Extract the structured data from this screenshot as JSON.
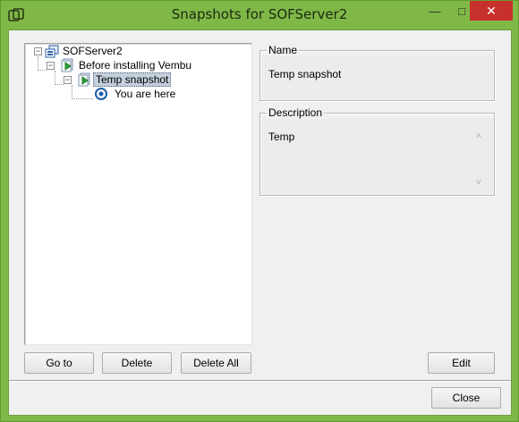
{
  "window": {
    "title": "Snapshots for SOFServer2",
    "minimize_glyph": "—",
    "maximize_glyph": "□",
    "close_glyph": "✕"
  },
  "tree": {
    "root": {
      "label": "SOFServer2",
      "icon": "vm-server-icon"
    },
    "items": [
      {
        "label": "Before installing Vembu",
        "icon": "snapshot-icon"
      },
      {
        "label": "Temp snapshot",
        "icon": "snapshot-icon",
        "selected": true
      },
      {
        "label": "You are here",
        "icon": "current-state-icon"
      }
    ],
    "expander_glyph": "−"
  },
  "details": {
    "name_label": "Name",
    "name_value": "Temp snapshot",
    "description_label": "Description",
    "description_value": "Temp",
    "scroll_up": "˄",
    "scroll_down": "˅"
  },
  "buttons": {
    "goto": "Go to",
    "delete": "Delete",
    "delete_all": "Delete All",
    "edit": "Edit",
    "close": "Close"
  },
  "colors": {
    "titlebar": "#80b848",
    "close_button": "#c7312b",
    "selection": "#c5d0de"
  }
}
